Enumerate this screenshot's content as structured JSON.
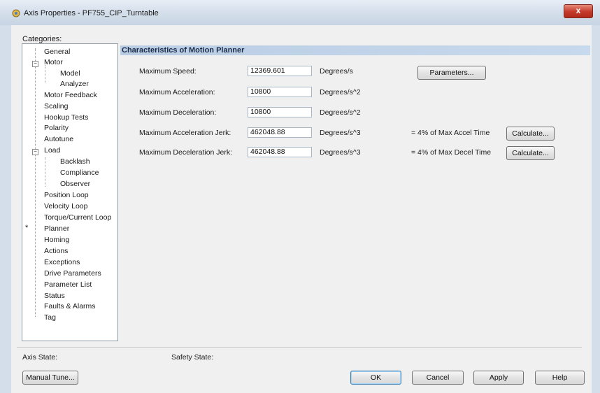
{
  "window": {
    "title": "Axis Properties - PF755_CIP_Turntable",
    "close_symbol": "x"
  },
  "categories": {
    "label": "Categories:",
    "items": [
      {
        "label": "General"
      },
      {
        "label": "Motor"
      },
      {
        "label": "Model"
      },
      {
        "label": "Analyzer"
      },
      {
        "label": "Motor Feedback"
      },
      {
        "label": "Scaling"
      },
      {
        "label": "Hookup Tests"
      },
      {
        "label": "Polarity"
      },
      {
        "label": "Autotune"
      },
      {
        "label": "Load"
      },
      {
        "label": "Backlash"
      },
      {
        "label": "Compliance"
      },
      {
        "label": "Observer"
      },
      {
        "label": "Position Loop"
      },
      {
        "label": "Velocity Loop"
      },
      {
        "label": "Torque/Current Loop"
      },
      {
        "label": "Planner"
      },
      {
        "label": "Homing"
      },
      {
        "label": "Actions"
      },
      {
        "label": "Exceptions"
      },
      {
        "label": "Drive Parameters"
      },
      {
        "label": "Parameter List"
      },
      {
        "label": "Status"
      },
      {
        "label": "Faults & Alarms"
      },
      {
        "label": "Tag"
      }
    ],
    "selected_marker": "*"
  },
  "section": {
    "title": "Characteristics of Motion Planner"
  },
  "fields": [
    {
      "label": "Maximum Speed:",
      "value": "12369.601",
      "unit": "Degrees/s"
    },
    {
      "label": "Maximum Acceleration:",
      "value": "10800",
      "unit": "Degrees/s^2"
    },
    {
      "label": "Maximum Deceleration:",
      "value": "10800",
      "unit": "Degrees/s^2"
    },
    {
      "label": "Maximum Acceleration Jerk:",
      "value": "462048.88",
      "unit": "Degrees/s^3",
      "note": "= 4% of Max Accel Time"
    },
    {
      "label": "Maximum Deceleration Jerk:",
      "value": "462048.88",
      "unit": "Degrees/s^3",
      "note": "= 4% of Max Decel Time"
    }
  ],
  "buttons": {
    "parameters": "Parameters...",
    "calculate": "Calculate...",
    "manual_tune": "Manual Tune...",
    "ok": "OK",
    "cancel": "Cancel",
    "apply": "Apply",
    "help": "Help"
  },
  "status": {
    "axis_state_label": "Axis State:",
    "safety_state_label": "Safety State:"
  },
  "colors": {
    "section_header_bg": "#c1d4e8",
    "close_button": "#c4392a"
  }
}
